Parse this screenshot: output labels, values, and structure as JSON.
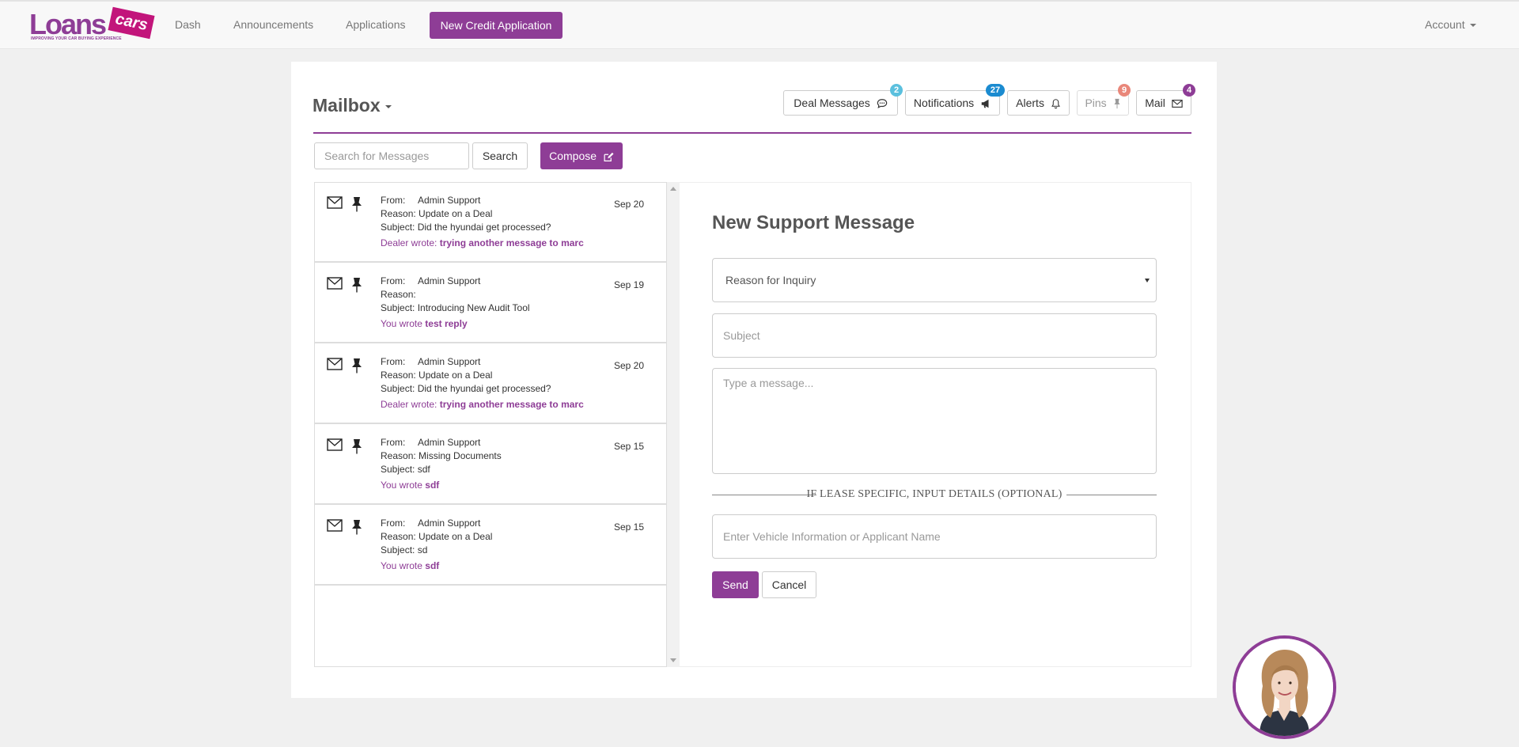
{
  "brand": {
    "word": "Loans",
    "tag": "cars",
    "tagline": "IMPROVING YOUR CAR BUYING EXPERIENCE",
    "primary_color": "#8e3d96",
    "tag_color": "#c2157b"
  },
  "nav": {
    "links": [
      "Dash",
      "Announcements",
      "Applications"
    ],
    "cta": "New Credit Application",
    "account": "Account"
  },
  "mailbox": {
    "title": "Mailbox",
    "buttons": {
      "deal_messages": {
        "label": "Deal Messages",
        "badge": "2",
        "badge_color": "#5bc0de",
        "icon": "comment-icon"
      },
      "notifications": {
        "label": "Notifications",
        "badge": "27",
        "badge_color": "#1b8bd0",
        "icon": "bullhorn-icon"
      },
      "alerts": {
        "label": "Alerts",
        "icon": "bell-icon"
      },
      "pins": {
        "label": "Pins",
        "badge": "9",
        "badge_color": "#e9877a",
        "icon": "pin-icon"
      },
      "mail": {
        "label": "Mail",
        "badge": "4",
        "badge_color": "#8e3d96",
        "icon": "envelope-icon"
      }
    },
    "search": {
      "placeholder": "Search for Messages",
      "button": "Search"
    },
    "compose": "Compose"
  },
  "messages": [
    {
      "from_label": "From:",
      "from": "Admin Support",
      "reason_label": "Reason:",
      "reason": "Update on a Deal",
      "subject_label": "Subject:",
      "subject": "Did the hyundai get processed?",
      "date": "Sep 20",
      "preview_prefix": "Dealer wrote:",
      "preview": "trying another message to marc"
    },
    {
      "from_label": "From:",
      "from": "Admin Support",
      "reason_label": "Reason:",
      "reason": "",
      "subject_label": "Subject:",
      "subject": "Introducing New Audit Tool",
      "date": "Sep 19",
      "preview_prefix": "You wrote",
      "preview": "test reply"
    },
    {
      "from_label": "From:",
      "from": "Admin Support",
      "reason_label": "Reason:",
      "reason": "Update on a Deal",
      "subject_label": "Subject:",
      "subject": "Did the hyundai get processed?",
      "date": "Sep 20",
      "preview_prefix": "Dealer wrote:",
      "preview": "trying another message to marc"
    },
    {
      "from_label": "From:",
      "from": "Admin Support",
      "reason_label": "Reason:",
      "reason": "Missing Documents",
      "subject_label": "Subject:",
      "subject": "sdf",
      "date": "Sep 15",
      "preview_prefix": "You wrote",
      "preview": "sdf"
    },
    {
      "from_label": "From:",
      "from": "Admin Support",
      "reason_label": "Reason:",
      "reason": "Update on a Deal",
      "subject_label": "Subject:",
      "subject": "sd",
      "date": "Sep 15",
      "preview_prefix": "You wrote",
      "preview": "sdf"
    }
  ],
  "form": {
    "title": "New Support Message",
    "reason_selected": "Reason for Inquiry",
    "subject_placeholder": "Subject",
    "message_placeholder": "Type a message...",
    "divider": "IF LEASE SPECIFIC, INPUT DETAILS (OPTIONAL)",
    "vehicle_placeholder": "Enter Vehicle Information or Applicant Name",
    "send": "Send",
    "cancel": "Cancel"
  }
}
